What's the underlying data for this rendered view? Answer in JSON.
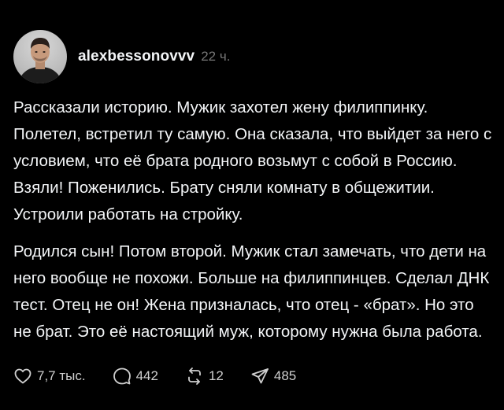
{
  "post": {
    "username": "alexbessonovvv",
    "timestamp": "22 ч.",
    "paragraphs": [
      "Рассказали историю. Мужик захотел жену филиппинку. Полетел, встретил ту самую. Она сказала, что выйдет за него с условием, что её брата родного возьмут с собой в Россию. Взяли! Поженились. Брату сняли комнату в общежитии. Устроили работать на стройку.",
      "Родился сын! Потом второй. Мужик стал замечать, что дети на него вообще не похожи. Больше на филиппинцев. Сделал ДНК тест. Отец не он! Жена призналась, что отец - «брат». Но это не брат. Это её настоящий муж, которому нужна была работа."
    ],
    "actions": {
      "likes": "7,7 тыс.",
      "replies": "442",
      "reposts": "12",
      "shares": "485"
    }
  },
  "icons": {
    "like": "heart-icon",
    "reply": "comment-icon",
    "repost": "repost-icon",
    "share": "share-icon"
  },
  "colors": {
    "background": "#000000",
    "text": "#f3f5f7",
    "muted": "#777777"
  }
}
